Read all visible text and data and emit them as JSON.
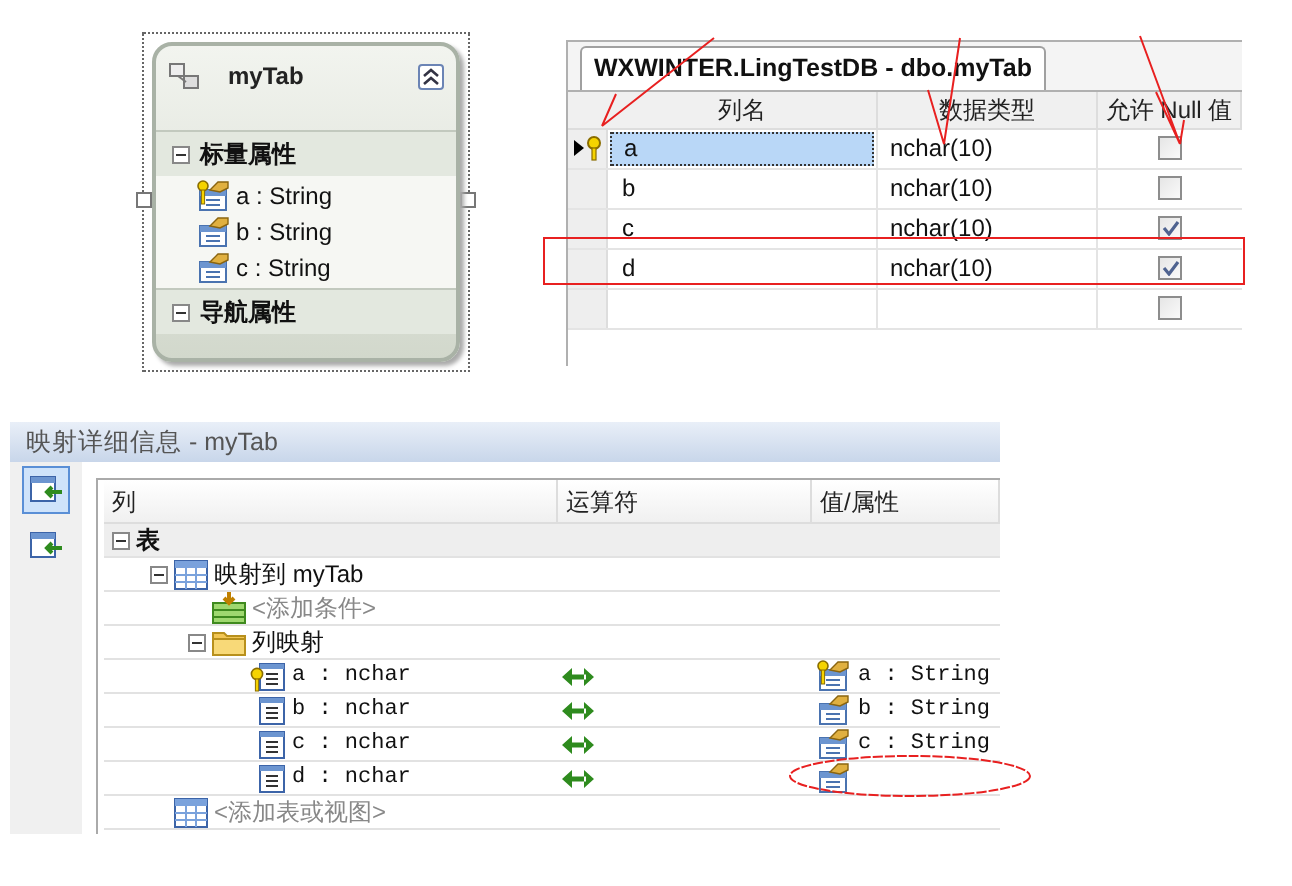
{
  "entity": {
    "title": "myTab",
    "collapsed": false,
    "sections": [
      {
        "title": "标量属性",
        "expanded": true,
        "properties": [
          {
            "label": "a : String",
            "key": true
          },
          {
            "label": "b : String",
            "key": false
          },
          {
            "label": "c : String",
            "key": false
          }
        ]
      },
      {
        "title": "导航属性",
        "expanded": true
      }
    ]
  },
  "designer": {
    "tab": "WXWINTER.LingTestDB - dbo.myTab",
    "columns": [
      "列名",
      "数据类型",
      "允许 Null 值"
    ],
    "rows": [
      {
        "name": "a",
        "type": "nchar(10)",
        "allow_null": false,
        "selected": true,
        "key": true
      },
      {
        "name": "b",
        "type": "nchar(10)",
        "allow_null": false,
        "selected": false,
        "key": false
      },
      {
        "name": "c",
        "type": "nchar(10)",
        "allow_null": true,
        "selected": false,
        "key": false
      },
      {
        "name": "d",
        "type": "nchar(10)",
        "allow_null": true,
        "selected": false,
        "key": false
      },
      {
        "allow_null": false,
        "selected": false,
        "key": false
      }
    ]
  },
  "mapping": {
    "title": "映射详细信息 - myTab",
    "toolbar": [
      {
        "selected": true
      },
      {
        "selected": false
      }
    ],
    "columns": [
      "列",
      "运算符",
      "值/属性"
    ],
    "tree": [
      {
        "label": "表",
        "kind": "group",
        "expanded": true,
        "children": [
          {
            "label": "映射到 myTab",
            "kind": "table",
            "expanded": true,
            "children": [
              {
                "label": "<添加条件>",
                "kind": "condition"
              },
              {
                "label": "列映射",
                "kind": "folder",
                "expanded": true,
                "children": [
                  {
                    "label": "a : nchar",
                    "kind": "column",
                    "key": true,
                    "value": "a : String",
                    "value_key": true
                  },
                  {
                    "label": "b : nchar",
                    "kind": "column",
                    "key": false,
                    "value": "b : String",
                    "value_key": false
                  },
                  {
                    "label": "c : nchar",
                    "kind": "column",
                    "key": false,
                    "value": "c : String",
                    "value_key": false
                  },
                  {
                    "label": "d : nchar",
                    "kind": "column",
                    "key": false,
                    "value_key": false
                  }
                ]
              }
            ]
          },
          {
            "label": "<添加表或视图>",
            "kind": "add-table"
          }
        ]
      }
    ]
  }
}
